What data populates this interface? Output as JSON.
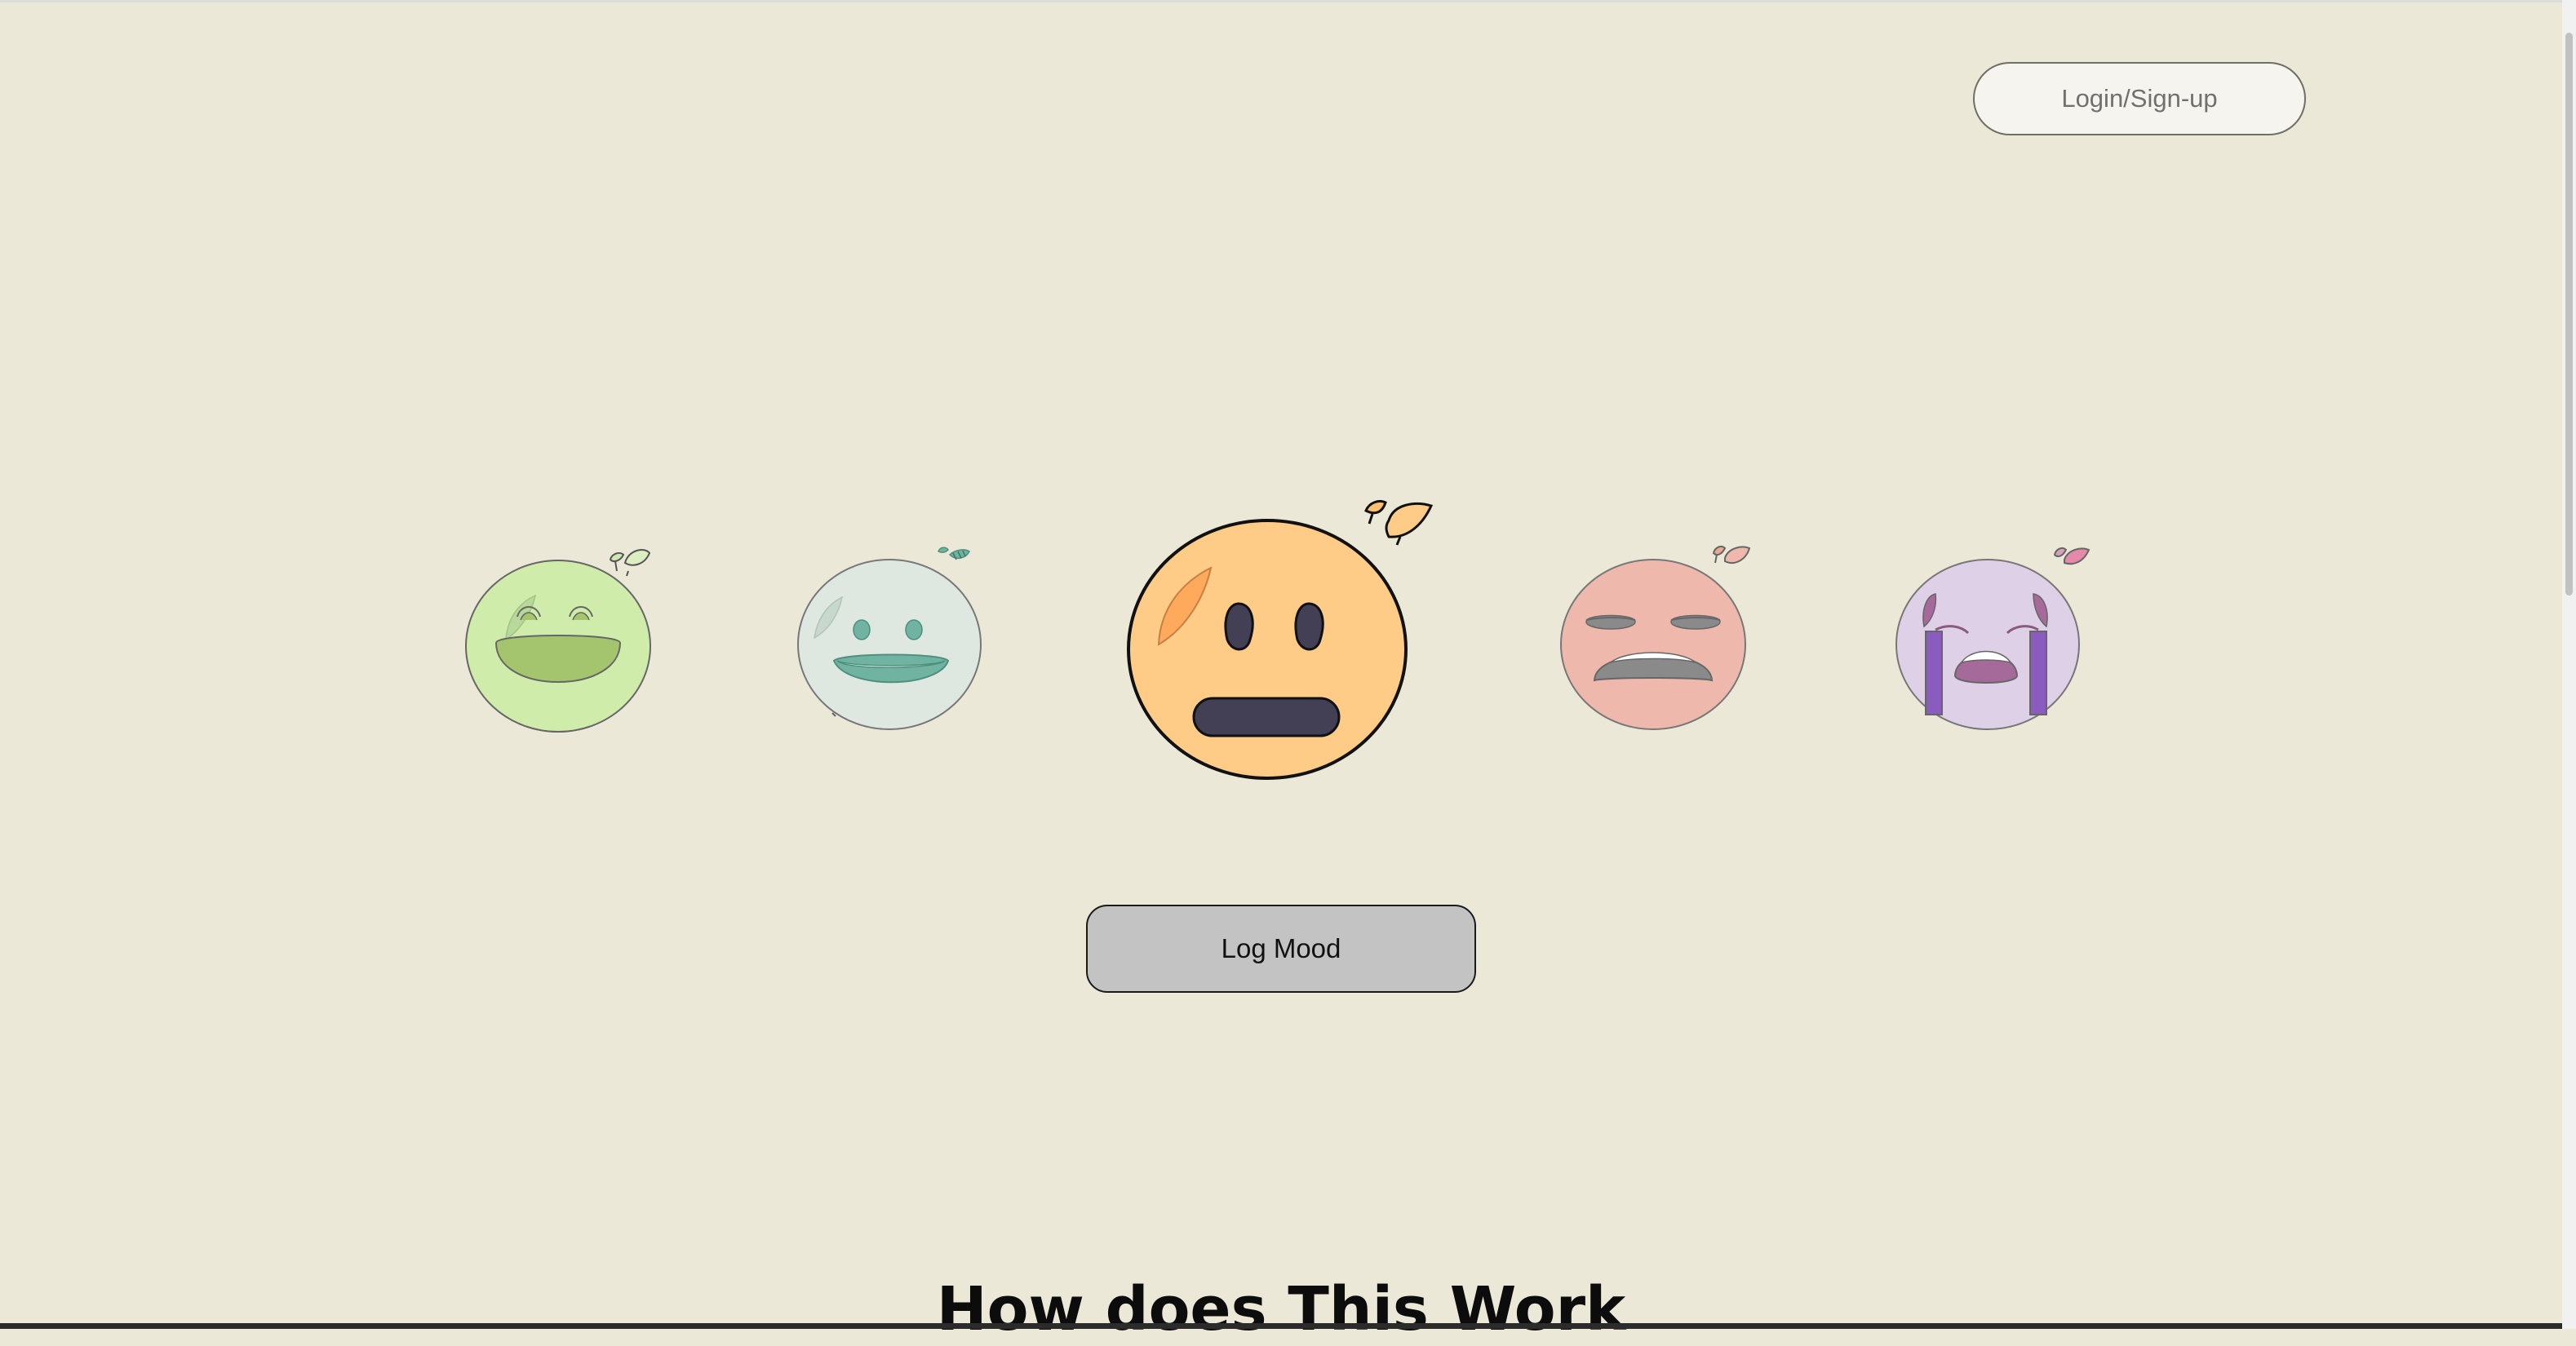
{
  "header": {
    "login_label": "Login/Sign-up"
  },
  "moods": [
    {
      "id": "very-happy",
      "face_color": "#cfecaa",
      "accent_color": "#a5c46e",
      "selected": false
    },
    {
      "id": "happy",
      "face_color": "#dfe8e0",
      "accent_color": "#6fb3a0",
      "selected": false
    },
    {
      "id": "neutral",
      "face_color": "#ffcc88",
      "accent_color": "#433f55",
      "selected": true
    },
    {
      "id": "sad",
      "face_color": "#eeb8ac",
      "accent_color": "#8a8a8a",
      "selected": false
    },
    {
      "id": "very-sad",
      "face_color": "#ded0e6",
      "accent_color": "#a66a9a",
      "selected": false
    }
  ],
  "actions": {
    "log_mood_label": "Log Mood"
  },
  "sections": {
    "how_it_works_title": "How does This Work"
  },
  "colors": {
    "page_background": "#ebe8d8",
    "button_background": "#c3c3c3"
  }
}
